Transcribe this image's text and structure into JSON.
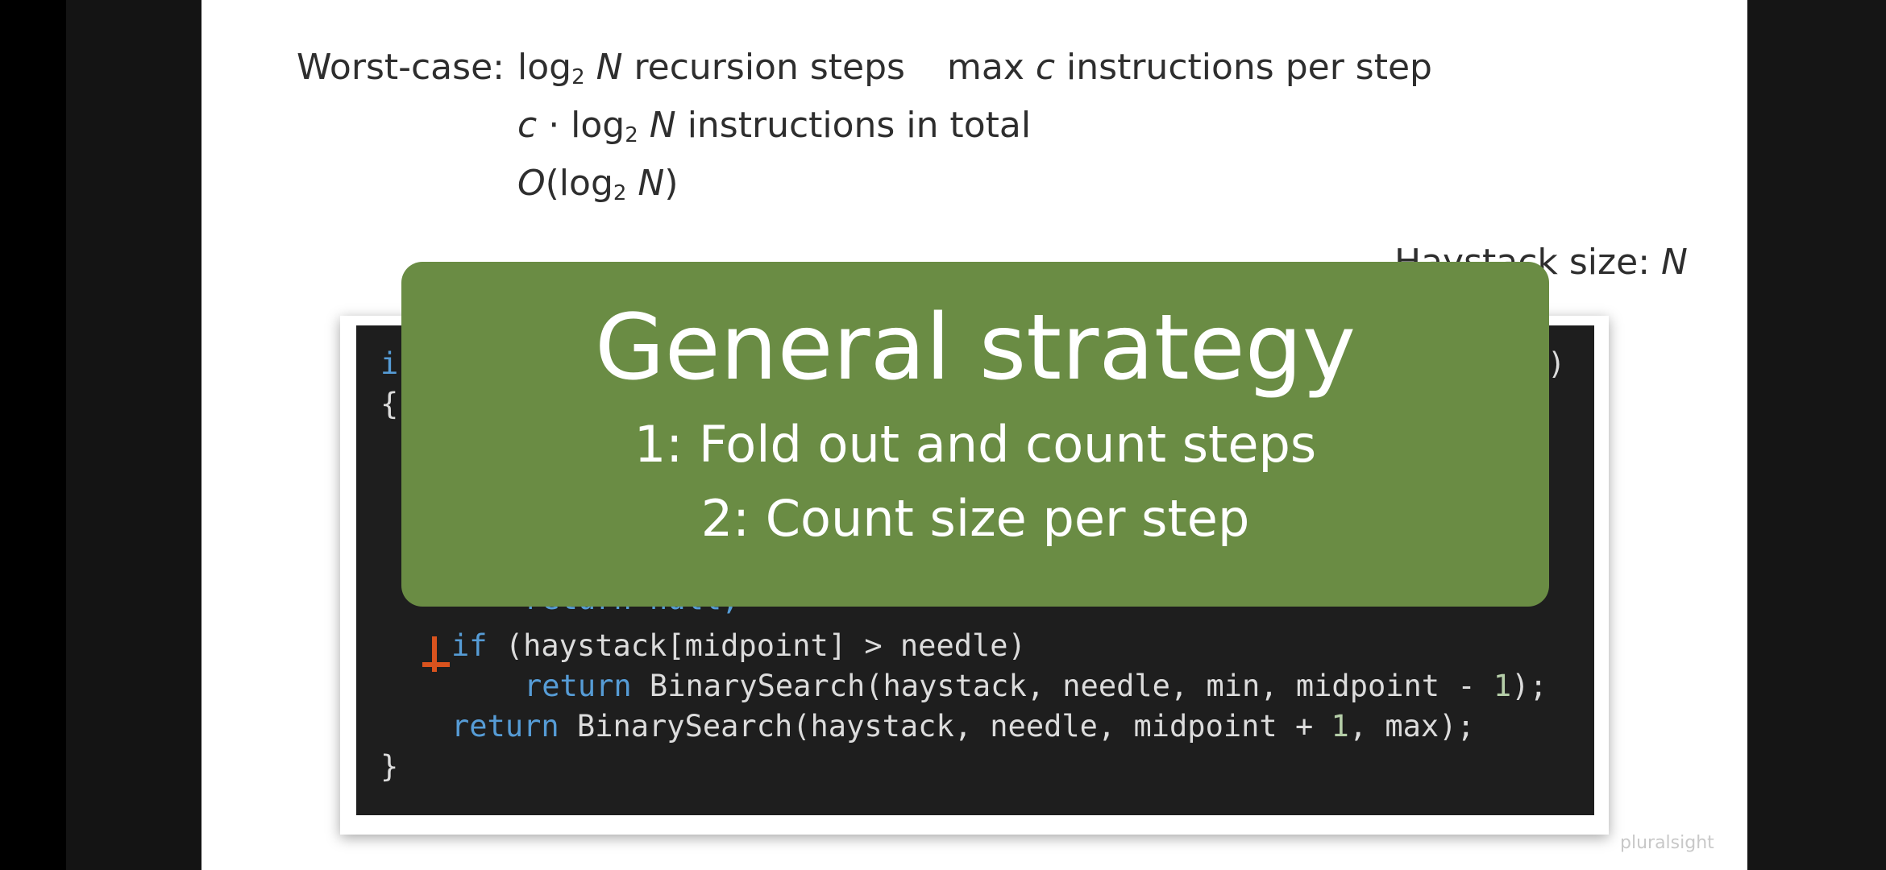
{
  "slide": {
    "worst_case_label": "Worst-case:",
    "line1": {
      "log": "log",
      "base": "2",
      "var": "N",
      "rest": " recursion steps"
    },
    "line1b": {
      "pre": "max ",
      "var": "c",
      "rest": " instructions per step"
    },
    "line2": {
      "var": "c",
      "dot": " · log",
      "base": "2",
      "var2": " N",
      "rest": " instructions in total"
    },
    "line3": {
      "o": "O",
      "open": "(log",
      "base": "2",
      "var": " N",
      "close": ")"
    },
    "haystack": {
      "label": "Haystack size: ",
      "var": "N"
    }
  },
  "code": {
    "line_int_start": "i",
    "line_int_end": ")",
    "brace_open": "{",
    "partial_return": "return null;",
    "if_kw": "if",
    "if_rest": " (haystack[midpoint] > needle)",
    "ret1_kw": "return",
    "ret1_rest": " BinarySearch(haystack, needle, min, midpoint - ",
    "ret1_num": "1",
    "ret1_end": ");",
    "ret2_kw": "return",
    "ret2_rest": " BinarySearch(haystack, needle, midpoint + ",
    "ret2_num": "1",
    "ret2_end": ", max);",
    "brace_close": "}"
  },
  "overlay": {
    "title": "General strategy",
    "step1": "1: Fold out and count steps",
    "step2": "2: Count size per step"
  },
  "watermark": "pluralsight",
  "colors": {
    "overlay_bg": "#6a8c44",
    "code_bg": "#1e1e1e",
    "keyword": "#569cd6",
    "number": "#b5cea8",
    "caret": "#d9531e"
  }
}
